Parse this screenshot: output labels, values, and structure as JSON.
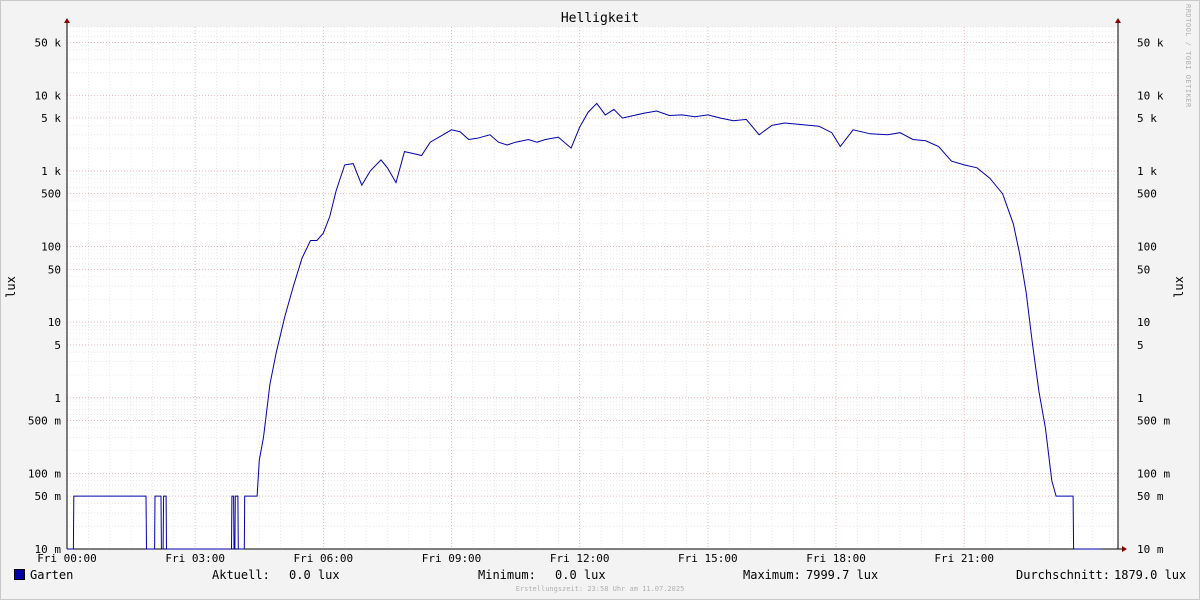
{
  "chart_data": {
    "type": "line",
    "title": "Helligkeit",
    "ylabel": "lux",
    "yscale": "log",
    "ylim": [
      0.01,
      80000
    ],
    "y_ticks": [
      {
        "v": 0.01,
        "label": "10 m"
      },
      {
        "v": 0.05,
        "label": "50 m"
      },
      {
        "v": 0.1,
        "label": "100 m"
      },
      {
        "v": 0.5,
        "label": "500 m"
      },
      {
        "v": 1,
        "label": "1"
      },
      {
        "v": 5,
        "label": "5"
      },
      {
        "v": 10,
        "label": "10"
      },
      {
        "v": 50,
        "label": "50"
      },
      {
        "v": 100,
        "label": "100"
      },
      {
        "v": 500,
        "label": "500"
      },
      {
        "v": 1000,
        "label": "1 k"
      },
      {
        "v": 5000,
        "label": "5 k"
      },
      {
        "v": 10000,
        "label": "10 k"
      },
      {
        "v": 50000,
        "label": "50 k"
      }
    ],
    "x_unit": "hours",
    "xlim": [
      0,
      24.6
    ],
    "x_ticks": [
      {
        "v": 0,
        "label": "Fri 00:00"
      },
      {
        "v": 3,
        "label": "Fri 03:00"
      },
      {
        "v": 6,
        "label": "Fri 06:00"
      },
      {
        "v": 9,
        "label": "Fri 09:00"
      },
      {
        "v": 12,
        "label": "Fri 12:00"
      },
      {
        "v": 15,
        "label": "Fri 15:00"
      },
      {
        "v": 18,
        "label": "Fri 18:00"
      },
      {
        "v": 21,
        "label": "Fri 21:00"
      }
    ],
    "series": [
      {
        "name": "Garten",
        "color": "#0000aa",
        "points": [
          [
            0,
            0.01
          ],
          [
            0.15,
            0.01
          ],
          [
            0.16,
            0.05
          ],
          [
            1.85,
            0.05
          ],
          [
            1.86,
            0.01
          ],
          [
            2.05,
            0.01
          ],
          [
            2.06,
            0.05
          ],
          [
            2.2,
            0.05
          ],
          [
            2.21,
            0.01
          ],
          [
            2.25,
            0.01
          ],
          [
            2.26,
            0.05
          ],
          [
            2.32,
            0.05
          ],
          [
            2.33,
            0.01
          ],
          [
            3.85,
            0.01
          ],
          [
            3.86,
            0.05
          ],
          [
            3.9,
            0.05
          ],
          [
            3.91,
            0.01
          ],
          [
            3.93,
            0.01
          ],
          [
            3.94,
            0.05
          ],
          [
            4.0,
            0.05
          ],
          [
            4.01,
            0.01
          ],
          [
            4.15,
            0.01
          ],
          [
            4.16,
            0.05
          ],
          [
            4.45,
            0.05
          ],
          [
            4.5,
            0.15
          ],
          [
            4.6,
            0.3
          ],
          [
            4.75,
            1.5
          ],
          [
            4.9,
            4
          ],
          [
            5.1,
            12
          ],
          [
            5.3,
            30
          ],
          [
            5.5,
            70
          ],
          [
            5.7,
            120
          ],
          [
            5.85,
            120
          ],
          [
            6.0,
            150
          ],
          [
            6.15,
            250
          ],
          [
            6.3,
            550
          ],
          [
            6.5,
            1200
          ],
          [
            6.7,
            1250
          ],
          [
            6.8,
            900
          ],
          [
            6.9,
            650
          ],
          [
            7.1,
            1000
          ],
          [
            7.35,
            1400
          ],
          [
            7.5,
            1100
          ],
          [
            7.7,
            700
          ],
          [
            7.9,
            1800
          ],
          [
            8.1,
            1700
          ],
          [
            8.3,
            1600
          ],
          [
            8.5,
            2400
          ],
          [
            8.8,
            3000
          ],
          [
            9.0,
            3500
          ],
          [
            9.2,
            3300
          ],
          [
            9.4,
            2600
          ],
          [
            9.6,
            2700
          ],
          [
            9.9,
            3000
          ],
          [
            10.1,
            2400
          ],
          [
            10.3,
            2200
          ],
          [
            10.5,
            2400
          ],
          [
            10.8,
            2600
          ],
          [
            11.0,
            2400
          ],
          [
            11.2,
            2600
          ],
          [
            11.5,
            2800
          ],
          [
            11.8,
            2000
          ],
          [
            12.0,
            3800
          ],
          [
            12.2,
            6000
          ],
          [
            12.4,
            7800
          ],
          [
            12.6,
            5500
          ],
          [
            12.8,
            6500
          ],
          [
            13.0,
            5000
          ],
          [
            13.2,
            5300
          ],
          [
            13.5,
            5800
          ],
          [
            13.8,
            6200
          ],
          [
            14.1,
            5400
          ],
          [
            14.4,
            5500
          ],
          [
            14.7,
            5200
          ],
          [
            15.0,
            5500
          ],
          [
            15.3,
            5000
          ],
          [
            15.6,
            4600
          ],
          [
            15.9,
            4800
          ],
          [
            16.2,
            3000
          ],
          [
            16.5,
            4000
          ],
          [
            16.8,
            4300
          ],
          [
            17.2,
            4100
          ],
          [
            17.6,
            3900
          ],
          [
            17.9,
            3200
          ],
          [
            18.1,
            2100
          ],
          [
            18.4,
            3500
          ],
          [
            18.8,
            3100
          ],
          [
            19.2,
            3000
          ],
          [
            19.5,
            3200
          ],
          [
            19.8,
            2600
          ],
          [
            20.1,
            2500
          ],
          [
            20.4,
            2100
          ],
          [
            20.7,
            1350
          ],
          [
            21.0,
            1200
          ],
          [
            21.3,
            1100
          ],
          [
            21.6,
            800
          ],
          [
            21.9,
            500
          ],
          [
            22.15,
            200
          ],
          [
            22.3,
            80
          ],
          [
            22.45,
            25
          ],
          [
            22.6,
            5
          ],
          [
            22.75,
            1.2
          ],
          [
            22.9,
            0.4
          ],
          [
            23.05,
            0.08
          ],
          [
            23.15,
            0.05
          ],
          [
            23.55,
            0.05
          ],
          [
            23.56,
            0.01
          ],
          [
            24.2,
            0.01
          ]
        ]
      }
    ]
  },
  "legend": {
    "series_name": "Garten",
    "aktuell_label": "Aktuell:",
    "aktuell_value": "0.0 lux",
    "minimum_label": "Minimum:",
    "minimum_value": "0.0 lux",
    "maximum_label": "Maximum:",
    "maximum_value": "7999.7 lux",
    "avg_label": "Durchschnitt:",
    "avg_value": "1879.0 lux"
  },
  "footer": "Erstellungszeit: 23:58 Uhr am 11.07.2025",
  "watermark": "RRDTOOL / TOBI OETIKER"
}
